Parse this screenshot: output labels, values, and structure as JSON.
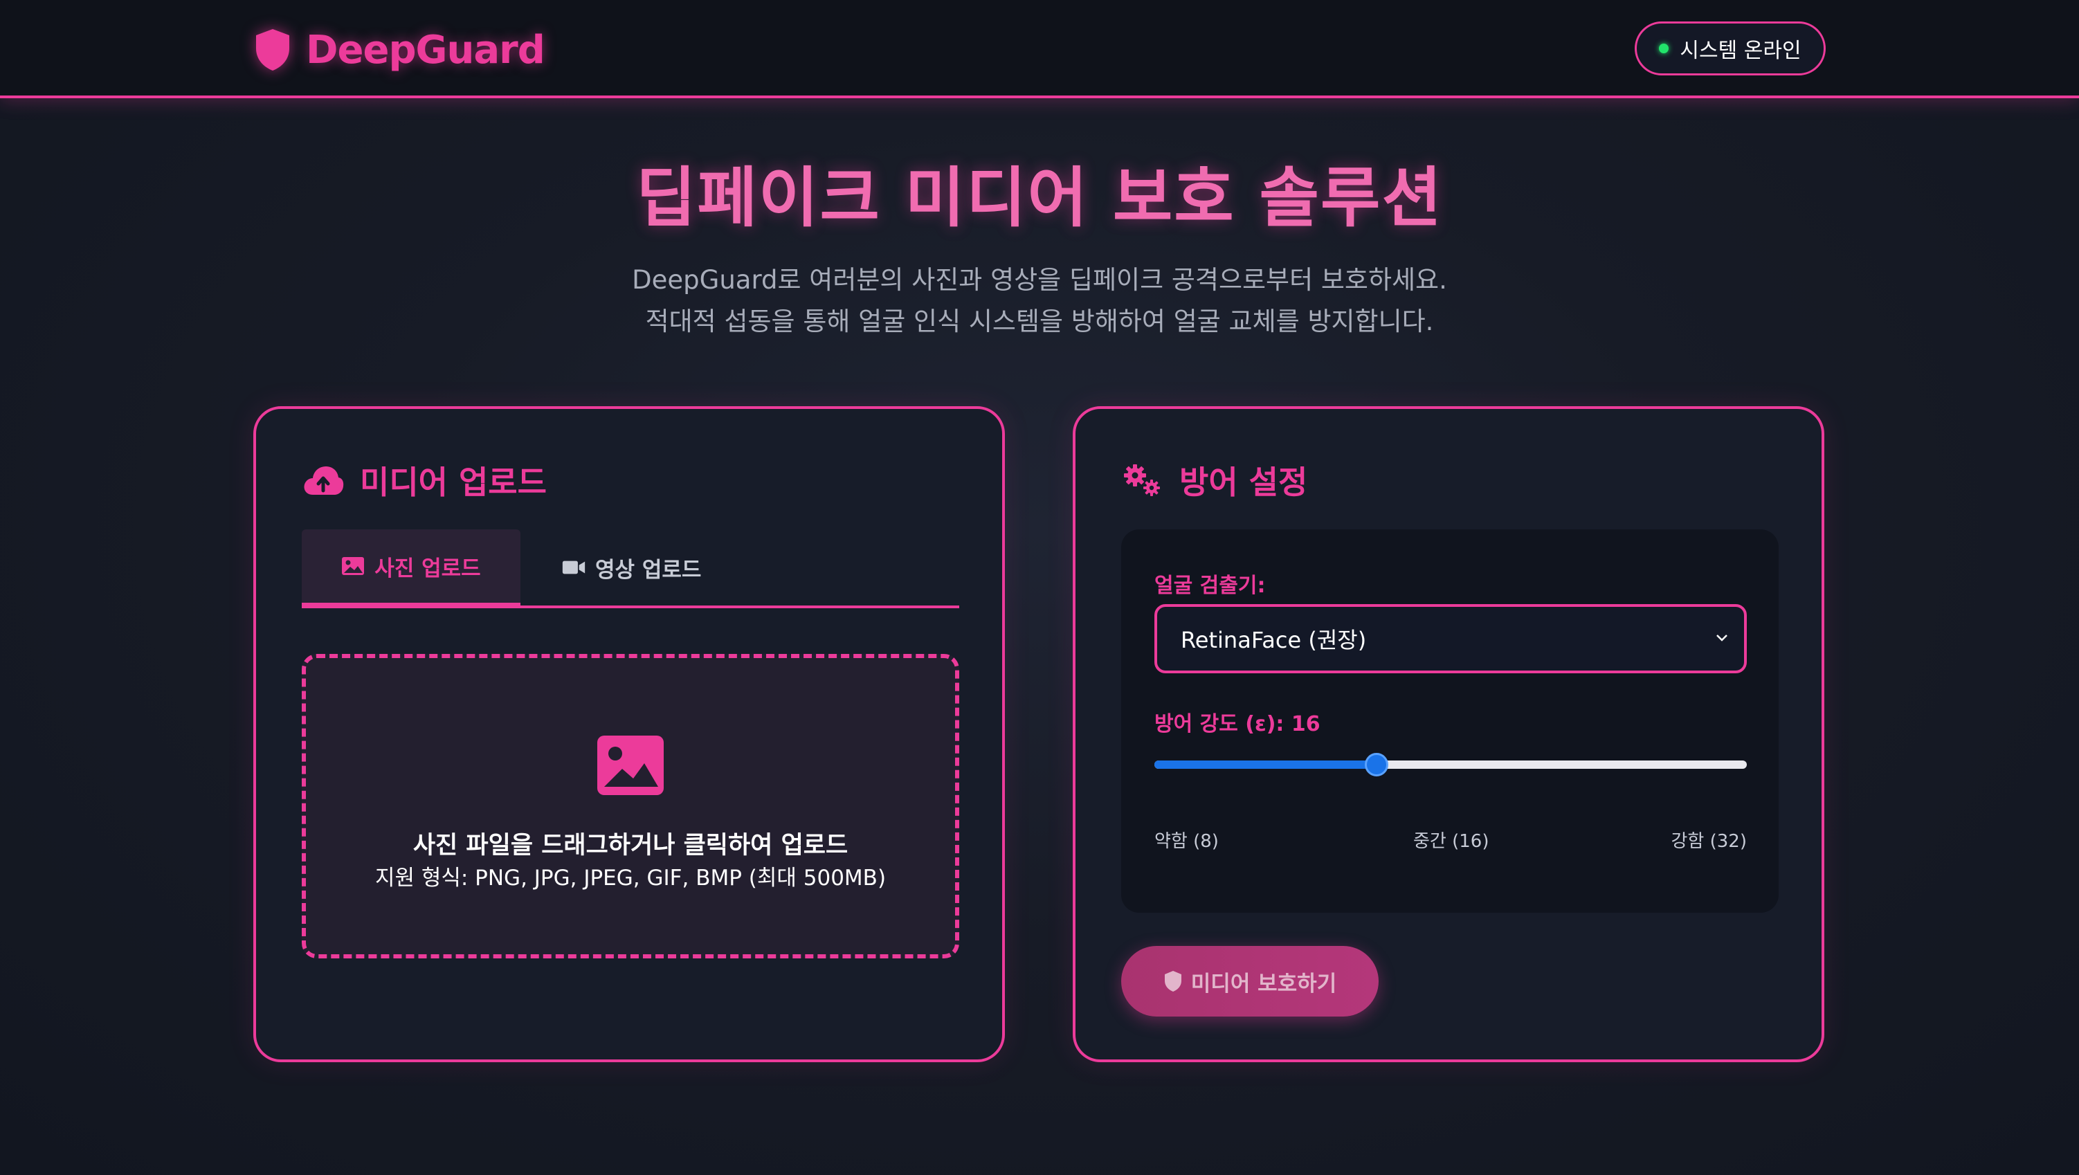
{
  "header": {
    "brand": "DeepGuard",
    "status": "시스템 온라인",
    "status_color": "#22e36b"
  },
  "hero": {
    "title": "딥페이크 미디어 보호 솔루션",
    "subtitle_1": "DeepGuard로 여러분의 사진과 영상을 딥페이크 공격으로부터 보호하세요.",
    "subtitle_2": "적대적 섭동을 통해 얼굴 인식 시스템을 방해하여 얼굴 교체를 방지합니다."
  },
  "upload_card": {
    "title": "미디어 업로드",
    "title_icon": "cloud-upload-icon",
    "tabs": [
      {
        "label": "사진 업로드",
        "icon": "image-icon",
        "active": true
      },
      {
        "label": "영상 업로드",
        "icon": "video-icon",
        "active": false
      }
    ],
    "dropzone": {
      "main": "사진 파일을 드래그하거나 클릭하여 업로드",
      "sub": "지원 형식: PNG, JPG, JPEG, GIF, BMP (최대 500MB)"
    }
  },
  "settings_card": {
    "title": "방어 설정",
    "title_icon": "gears-icon",
    "detector_label": "얼굴 검출기:",
    "detector_value": "RetinaFace (권장)",
    "strength_label": "방어 강도 (ε): 16",
    "strength": {
      "min": 4,
      "max": 36,
      "value": 16
    },
    "ticks": [
      "약함 (8)",
      "중간 (16)",
      "강함 (32)"
    ],
    "protect_button": "미디어 보호하기"
  },
  "colors": {
    "accent": "#ec3b9a",
    "slider": "#1a73e8",
    "background": "#171b26"
  }
}
